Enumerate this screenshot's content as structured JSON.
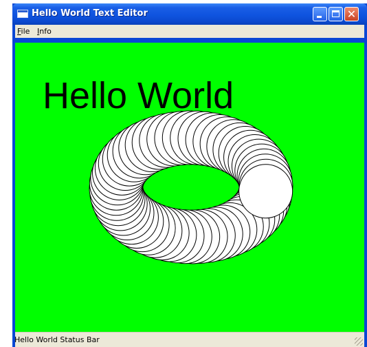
{
  "window": {
    "title": "Hello World Text Editor",
    "buttons": {
      "minimize_icon": "minimize-icon",
      "maximize_icon": "maximize-icon",
      "close_symbol": "✕"
    }
  },
  "menu": {
    "items": [
      {
        "accel": "F",
        "rest": "ile"
      },
      {
        "accel": "I",
        "rest": "nfo"
      }
    ]
  },
  "canvas": {
    "text": "Hello World",
    "background": "#00ff00",
    "ring_stroke": "#000000",
    "ring_fill": "#ffffff"
  },
  "status": {
    "text": "Hello World Status Bar"
  }
}
